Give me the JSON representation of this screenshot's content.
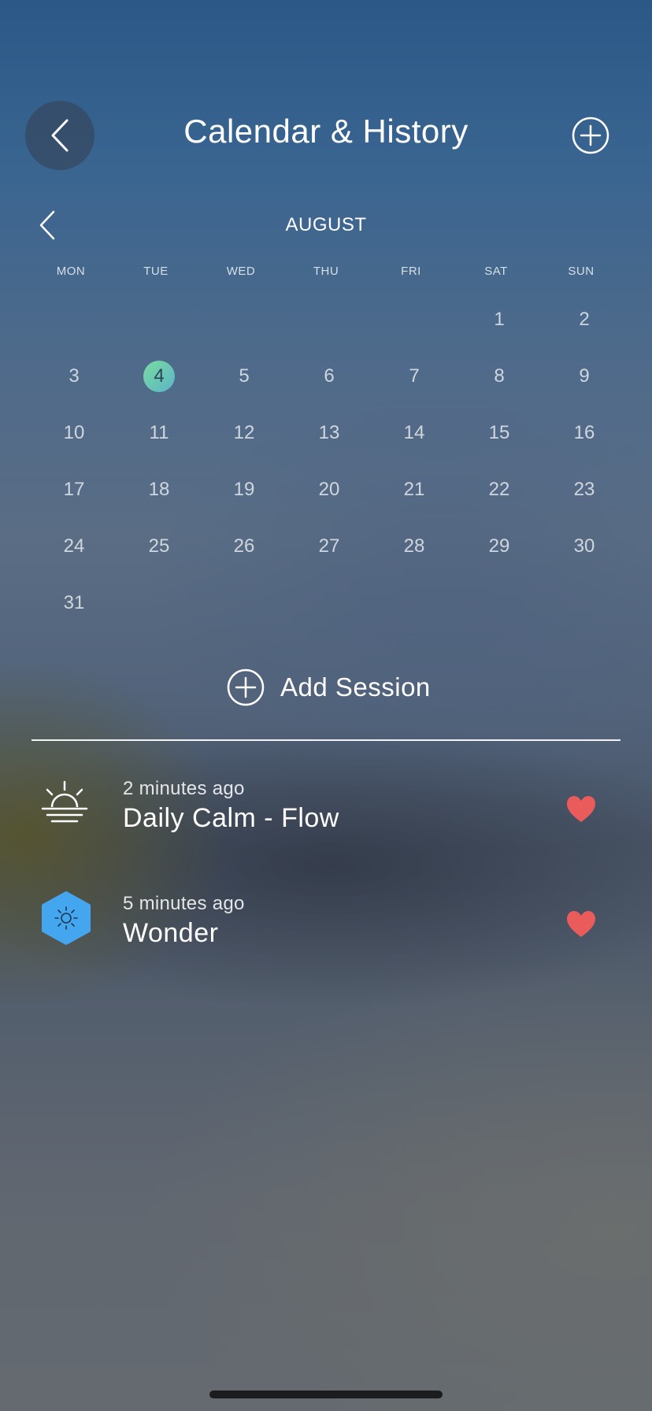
{
  "header": {
    "title": "Calendar & History",
    "back_icon": "chevron-left-icon",
    "add_icon": "plus-circle-icon"
  },
  "calendar": {
    "month": "AUGUST",
    "prev_icon": "chevron-left-icon",
    "weekdays": [
      "MON",
      "TUE",
      "WED",
      "THU",
      "FRI",
      "SAT",
      "SUN"
    ],
    "days": [
      "",
      "",
      "",
      "",
      "",
      "1",
      "2",
      "3",
      "4",
      "5",
      "6",
      "7",
      "8",
      "9",
      "10",
      "11",
      "12",
      "13",
      "14",
      "15",
      "16",
      "17",
      "18",
      "19",
      "20",
      "21",
      "22",
      "23",
      "24",
      "25",
      "26",
      "27",
      "28",
      "29",
      "30",
      "31",
      "",
      "",
      "",
      "",
      "",
      ""
    ],
    "selected_day": "4",
    "selected_color_start": "#79dca1",
    "selected_color_end": "#5bb4c6"
  },
  "add_session": {
    "label": "Add Session",
    "icon": "plus-circle-icon"
  },
  "sessions": [
    {
      "time": "2 minutes ago",
      "name": "Daily Calm - Flow",
      "icon": "sunrise-icon",
      "favorite_icon": "heart-icon"
    },
    {
      "time": "5 minutes ago",
      "name": "Wonder",
      "icon": "sun-hexagon-icon",
      "favorite_icon": "heart-icon"
    }
  ],
  "colors": {
    "heart": "#ea5b5b",
    "hexagon": "#45a6f0",
    "home_indicator": "#1c1c1e"
  }
}
